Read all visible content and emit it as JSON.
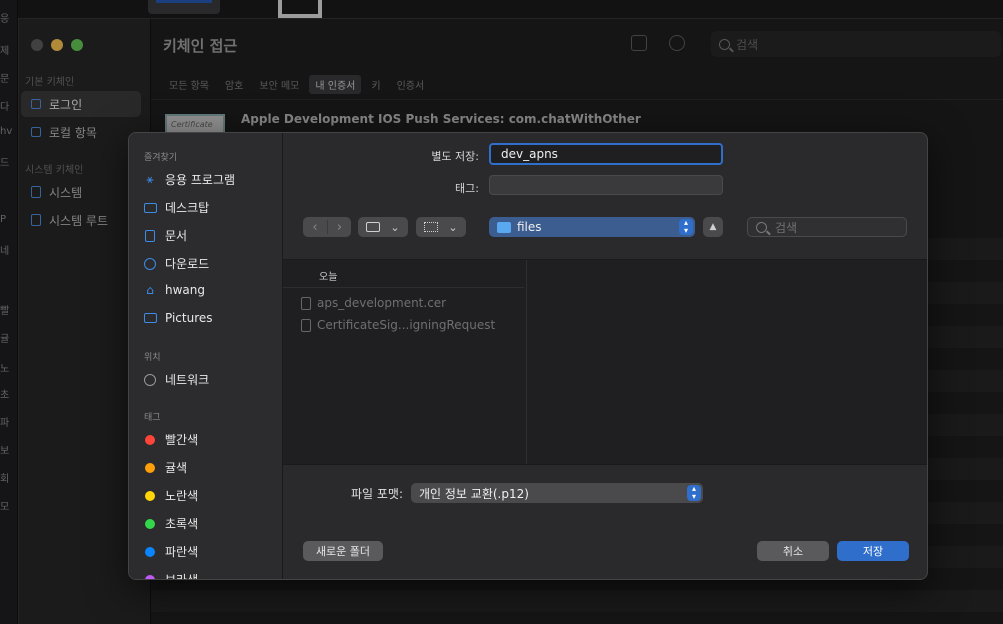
{
  "keychain": {
    "title": "키체인 접근",
    "search_placeholder": "검색",
    "sidebar": {
      "section1": "기본 키체인",
      "items1": [
        "로그인",
        "로컬 항목"
      ],
      "section2": "시스템 키체인",
      "items2": [
        "시스템",
        "시스템 루트"
      ]
    },
    "tabs": [
      "모든 항목",
      "암호",
      "보안 메모",
      "내 인증서",
      "키",
      "인증서"
    ],
    "selected_tab": "내 인증서",
    "certificate_title": "Apple Development IOS Push Services: com.chatWithOther",
    "certificate_thumb_text": "Certificate",
    "bg_app_letters": [
      "응",
      "제",
      "문",
      "다",
      "hv",
      "드",
      "P",
      "네",
      "빨",
      "귤",
      "노",
      "초",
      "파",
      "보",
      "회",
      "모"
    ]
  },
  "save_sheet": {
    "sidebar": {
      "favorites_label": "즐겨찾기",
      "favorites": [
        {
          "label": "응용 프로그램",
          "icon": "apps-icon"
        },
        {
          "label": "데스크탑",
          "icon": "desktop-icon"
        },
        {
          "label": "문서",
          "icon": "document-icon"
        },
        {
          "label": "다운로드",
          "icon": "download-icon"
        },
        {
          "label": "hwang",
          "icon": "home-icon"
        },
        {
          "label": "Pictures",
          "icon": "pictures-icon"
        }
      ],
      "locations_label": "위치",
      "locations": [
        {
          "label": "네트워크",
          "icon": "globe-icon"
        }
      ],
      "tags_label": "태그",
      "tags": [
        {
          "label": "빨간색",
          "color": "#ff453a"
        },
        {
          "label": "귤색",
          "color": "#ff9f0a"
        },
        {
          "label": "노란색",
          "color": "#ffd60a"
        },
        {
          "label": "초록색",
          "color": "#32d74b"
        },
        {
          "label": "파란색",
          "color": "#0a84ff"
        },
        {
          "label": "보라색",
          "color": "#bf5af2"
        }
      ]
    },
    "save_as_label": "별도 저장:",
    "save_as_value": "dev_apns",
    "tags_label": "태그:",
    "tags_value": "",
    "location": "files",
    "search_placeholder": "검색",
    "browser": {
      "column_header": "오늘",
      "files": [
        "aps_development.cer",
        "CertificateSig...igningRequest"
      ]
    },
    "format_label": "파일 포맷:",
    "format_value": "개인 정보 교환(.p12)",
    "new_folder": "새로운 폴더",
    "cancel": "취소",
    "save": "저장",
    "accent": "#2f6fcb"
  }
}
